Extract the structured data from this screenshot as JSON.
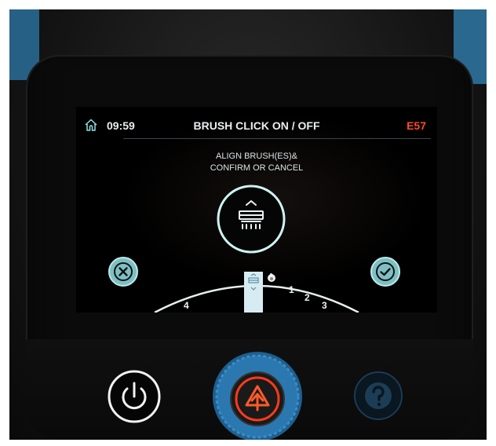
{
  "header": {
    "time": "09:59",
    "title": "BRUSH CLICK ON / OFF",
    "error_code": "E57"
  },
  "instruction": {
    "line1": "ALIGN BRUSH(ES)&",
    "line2": "CONFIRM OR CANCEL"
  },
  "selector": {
    "positions": [
      "4",
      "1",
      "2",
      "3"
    ]
  },
  "colors": {
    "accent": "#8fe3e6",
    "error": "#ff4a2a",
    "knob_blue": "#2b78b0",
    "warning_red": "#ff3a1a"
  },
  "icons": [
    "home-icon",
    "brush-icon",
    "cancel-icon",
    "confirm-icon",
    "hand-icon",
    "power-icon",
    "warning-icon",
    "help-icon"
  ]
}
